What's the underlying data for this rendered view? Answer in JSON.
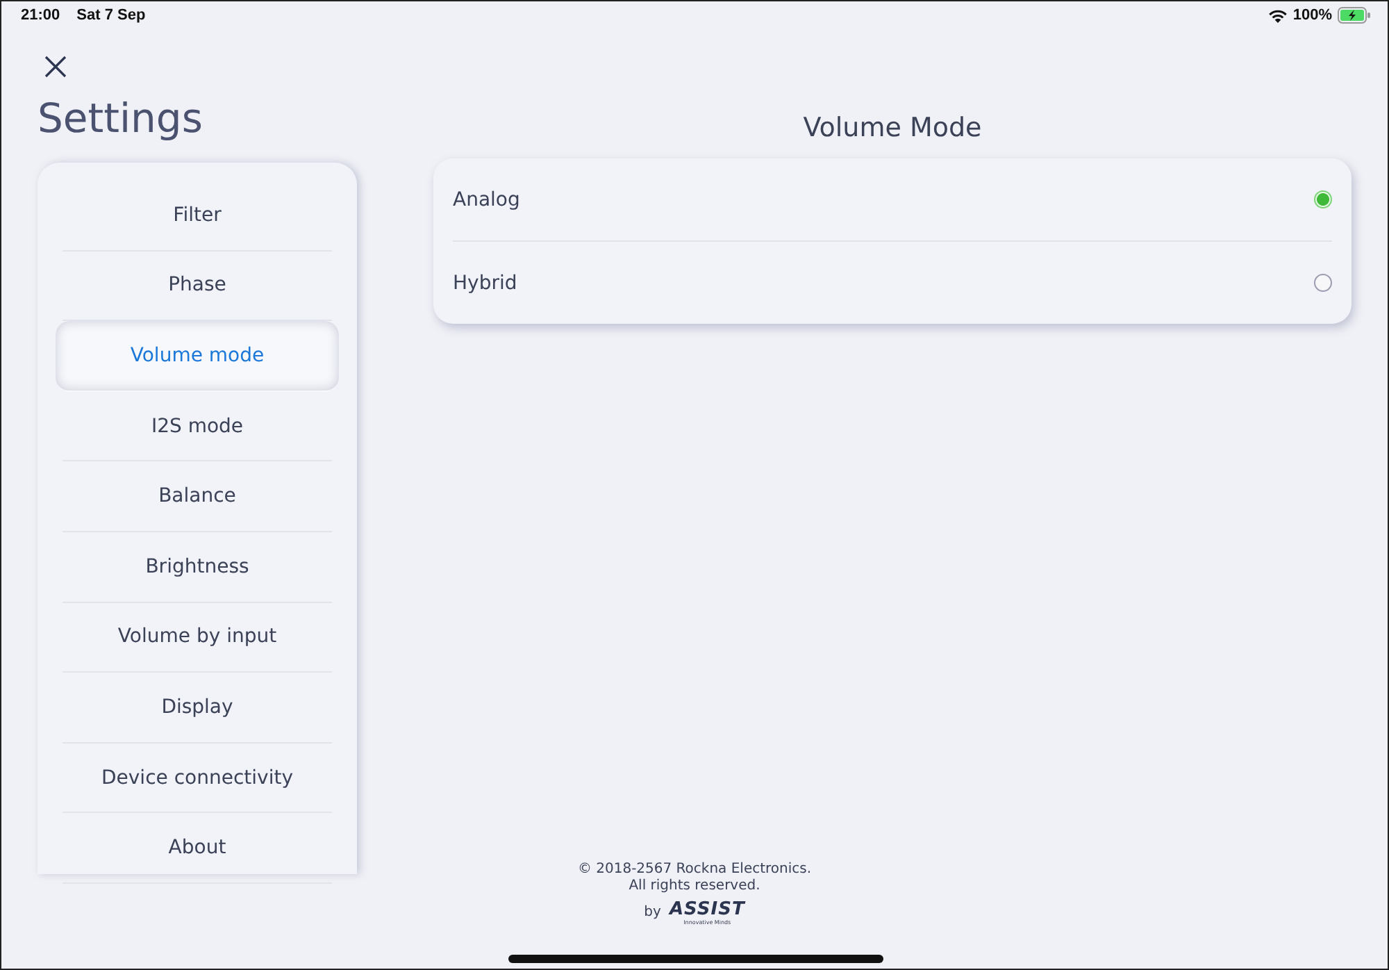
{
  "status_bar": {
    "time": "21:00",
    "date": "Sat 7 Sep",
    "battery": "100%",
    "charging": true
  },
  "title": "Settings",
  "sidebar": {
    "items": [
      {
        "label": "Filter",
        "selected": false
      },
      {
        "label": "Phase",
        "selected": false
      },
      {
        "label": "Volume mode",
        "selected": true
      },
      {
        "label": "I2S mode",
        "selected": false
      },
      {
        "label": "Balance",
        "selected": false
      },
      {
        "label": "Brightness",
        "selected": false
      },
      {
        "label": "Volume by input",
        "selected": false
      },
      {
        "label": "Display",
        "selected": false
      },
      {
        "label": "Device connectivity",
        "selected": false
      },
      {
        "label": "About",
        "selected": false
      }
    ]
  },
  "panel": {
    "title": "Volume Mode",
    "options": [
      {
        "label": "Analog",
        "selected": true
      },
      {
        "label": "Hybrid",
        "selected": false
      }
    ]
  },
  "footer": {
    "copyright": "© 2018-2567 Rockna Electronics.",
    "rights": "All rights reserved.",
    "by": "by",
    "logo": "ASSIST",
    "tagline": "Innovative Minds"
  }
}
